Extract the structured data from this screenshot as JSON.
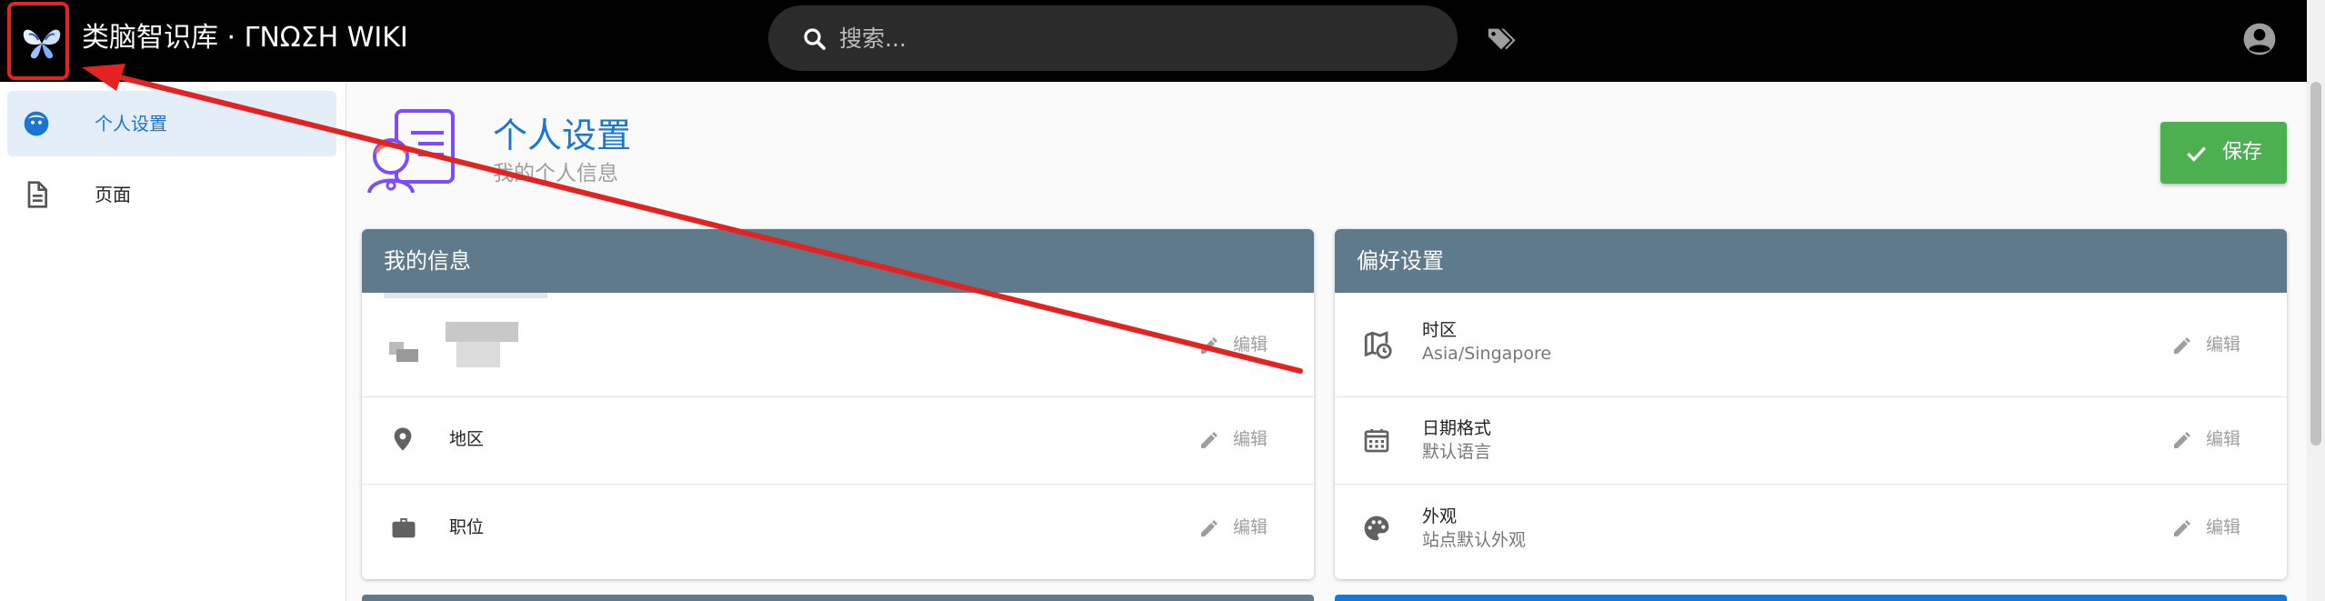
{
  "app": {
    "title": "类脑智识库 · ΓΝΩΣΗ WIKI"
  },
  "search": {
    "placeholder": "搜索..."
  },
  "sidebar": {
    "items": [
      {
        "label": "个人设置",
        "icon": "profile-icon",
        "active": true
      },
      {
        "label": "页面",
        "icon": "document-icon",
        "active": false
      }
    ]
  },
  "page": {
    "title": "个人设置",
    "subtitle": "我的个人信息",
    "save_label": "保存"
  },
  "my_info": {
    "title": "我的信息",
    "rows": [
      {
        "label": "",
        "edit": "编辑"
      },
      {
        "label": "地区",
        "edit": "编辑"
      },
      {
        "label": "职位",
        "edit": "编辑"
      }
    ]
  },
  "preferences": {
    "title": "偏好设置",
    "rows": [
      {
        "label": "时区",
        "value": "Asia/Singapore",
        "edit": "编辑"
      },
      {
        "label": "日期格式",
        "value": "默认语言",
        "edit": "编辑"
      },
      {
        "label": "外观",
        "value": "站点默认外观",
        "edit": "编辑"
      }
    ]
  },
  "colors": {
    "accent": "#1976d2",
    "header_card": "#5f7a8a",
    "save": "#4caf50",
    "annotation": "#e32222"
  }
}
